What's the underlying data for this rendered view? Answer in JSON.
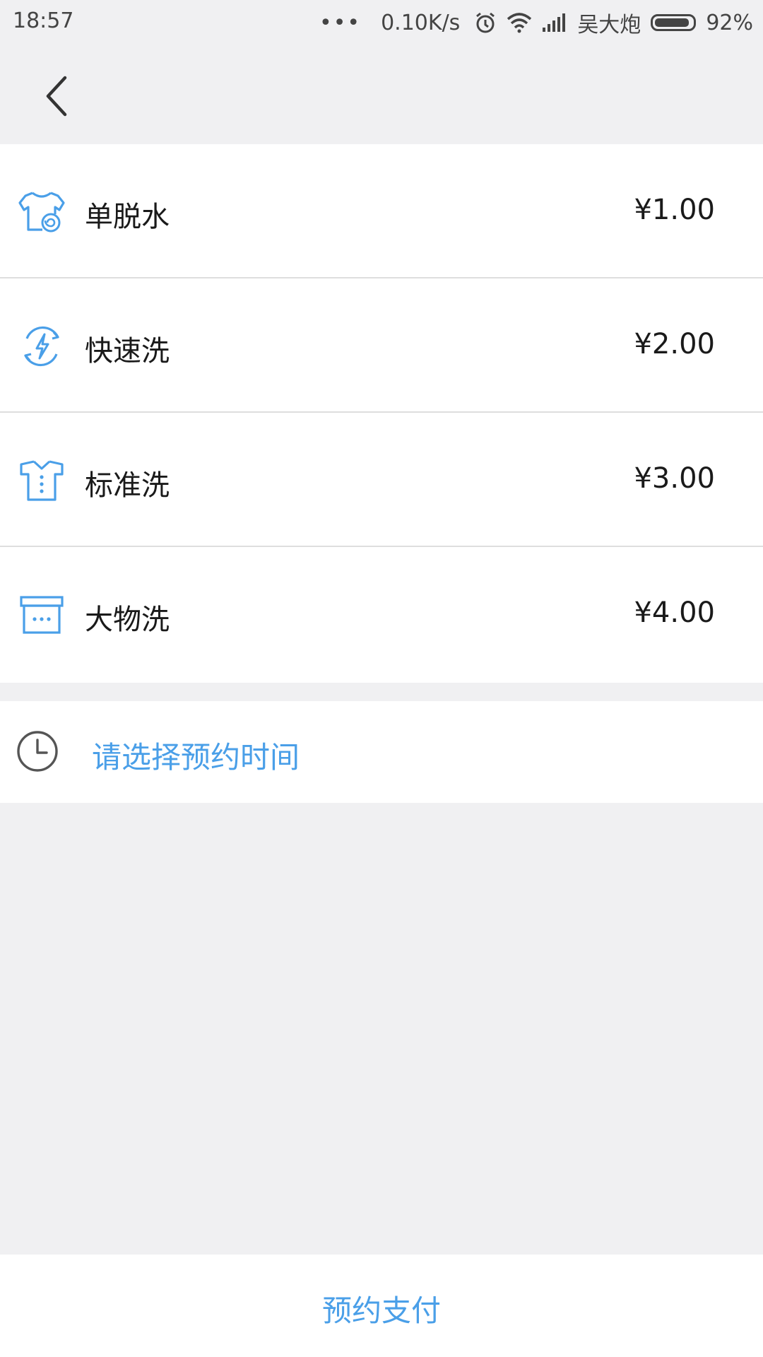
{
  "status_bar": {
    "time": "18:57",
    "dots": "•••",
    "net_speed": "0.10K/s",
    "carrier": "吴大炮",
    "battery": "92%",
    "battery_level": 0.92
  },
  "services": [
    {
      "icon": "shirt-spin-icon",
      "label": "单脱水",
      "price": "¥1.00"
    },
    {
      "icon": "lightning-refresh-icon",
      "label": "快速洗",
      "price": "¥2.00"
    },
    {
      "icon": "shirt-icon",
      "label": "标准洗",
      "price": "¥3.00"
    },
    {
      "icon": "box-icon",
      "label": "大物洗",
      "price": "¥4.00"
    }
  ],
  "time_select": {
    "icon": "clock-icon",
    "label": "请选择预约时间"
  },
  "footer": {
    "pay_label": "预约支付"
  },
  "colors": {
    "accent": "#4a9fe8",
    "icon_blue": "#4a9fe8",
    "background": "#f0f0f2"
  }
}
